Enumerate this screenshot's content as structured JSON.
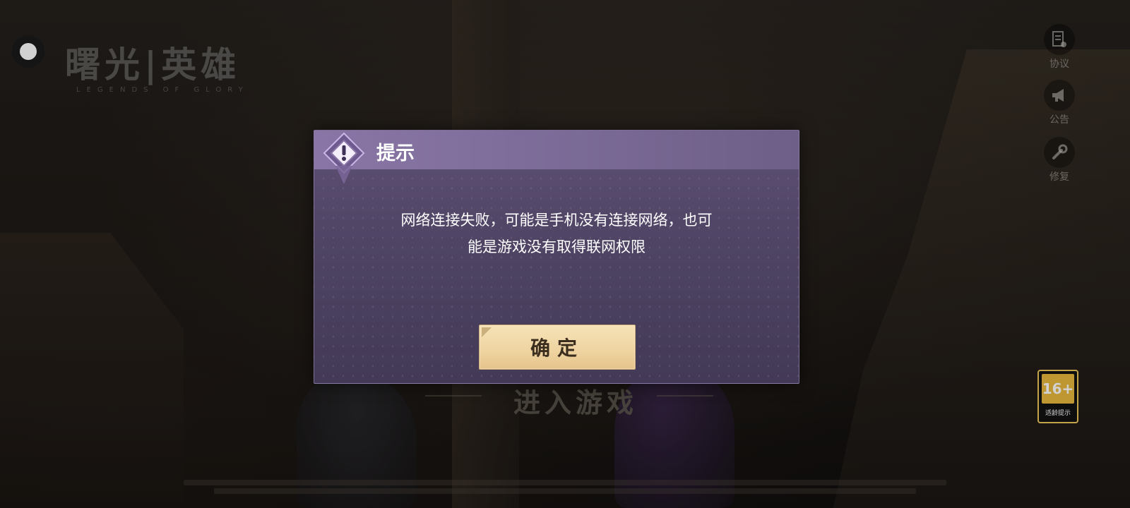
{
  "logo": {
    "title": "曙光|英雄",
    "subtitle": "LEGENDS OF GLORY"
  },
  "side_menu": [
    {
      "label": "协议",
      "icon": "agreement-icon"
    },
    {
      "label": "公告",
      "icon": "megaphone-icon"
    },
    {
      "label": "修复",
      "icon": "wrench-icon"
    }
  ],
  "age_rating": {
    "value": "16+",
    "label": "适龄提示",
    "accent_color": "#e8b93f"
  },
  "background": {
    "enter_game": "进入游戏"
  },
  "dialog": {
    "title": "提示",
    "message": "网络连接失败，可能是手机没有连接网络，也可\n能是游戏没有取得联网权限",
    "confirm_label": "确定",
    "header_color": "#8a76a6",
    "button_color": "#efd3a0"
  }
}
